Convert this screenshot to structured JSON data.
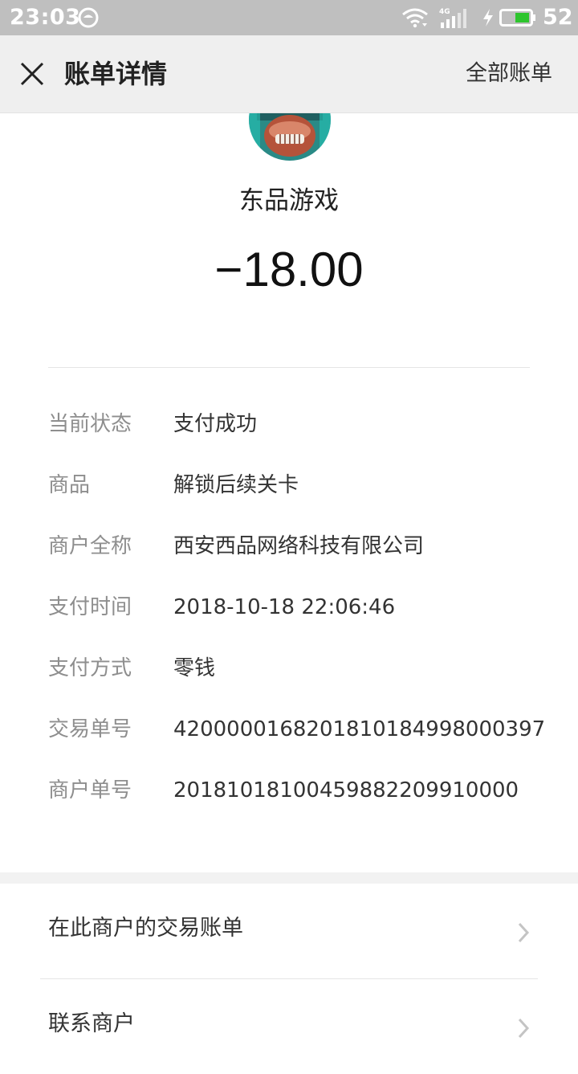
{
  "status_bar": {
    "time": "23:03",
    "network": "4G",
    "battery_level": "52",
    "icons": [
      "app-notification-icon",
      "wifi-icon",
      "cellular-signal-icon",
      "charging-icon",
      "battery-icon"
    ]
  },
  "nav": {
    "title": "账单详情",
    "right_action": "全部账单",
    "close_icon": "close-icon"
  },
  "merchant": {
    "name": "东品游戏",
    "amount": "−18.00",
    "avatar_icon": "game-character-avatar"
  },
  "details": [
    {
      "label": "当前状态",
      "value": "支付成功"
    },
    {
      "label": "商品",
      "value": "解锁后续关卡"
    },
    {
      "label": "商户全称",
      "value": "西安西品网络科技有限公司"
    },
    {
      "label": "支付时间",
      "value": "2018-10-18 22:06:46"
    },
    {
      "label": "支付方式",
      "value": "零钱"
    },
    {
      "label": "交易单号",
      "value": "4200000168201810184998000397"
    },
    {
      "label": "商户单号",
      "value": "20181018100459882209910000"
    }
  ],
  "actions": [
    {
      "label": "在此商户的交易账单"
    },
    {
      "label": "联系商户"
    }
  ],
  "colors": {
    "status_bar_bg": "#bfbfbf",
    "nav_bg": "#efefef",
    "label_gray": "#8e8e8e",
    "battery_green": "#2ec52e"
  }
}
